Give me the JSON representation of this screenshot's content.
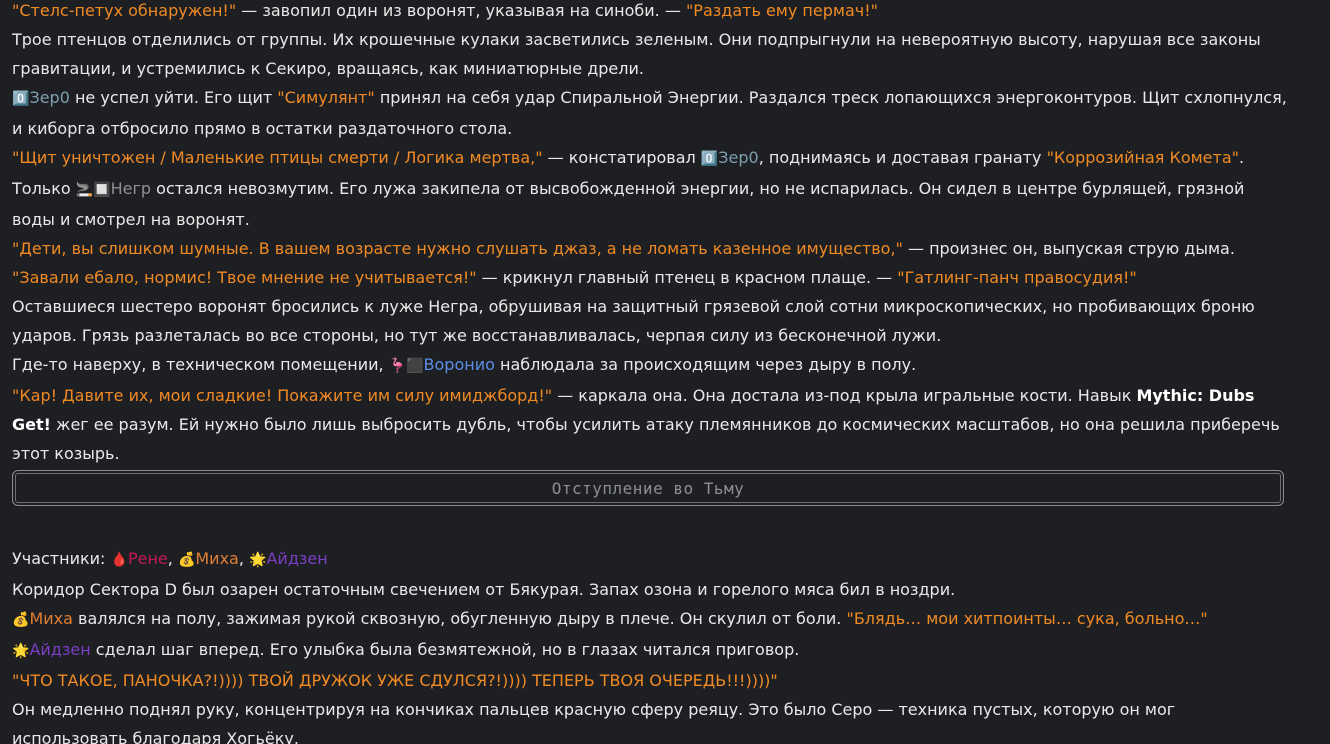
{
  "post1": {
    "l1_q1": "\"Стелс-петух обнаружен!\"",
    "l1_t": " — завопил один из воронят, указывая на синоби. — ",
    "l1_q2": "\"Раздать ему пермач!\"",
    "l2": "Трое птенцов отделились от группы. Их крошечные кулаки засветились зеленым. Они подпрыгнули на невероятную высоту, нарушая все законы гравитации, и устремились к Секиро, вращаясь, как миниатюрные дрели.",
    "l3_icon": "0️⃣",
    "l3_name": "Зер0",
    "l3_t1": " не успел уйти. Его щит ",
    "l3_q": "\"Симулянт\"",
    "l3_t2": " принял на себя удар Спиральной Энергии. Раздался треск лопающихся энергоконтуров. Щит схлопнулся, и киборга отбросило прямо в остатки раздаточного стола.",
    "l4_q1": "\"Щит уничтожен / Маленькие птицы смерти / Логика мертва,\"",
    "l4_t1": " — констатировал ",
    "l4_icon": "0️⃣",
    "l4_name": "Зер0",
    "l4_t2": ", поднимаясь и доставая гранату ",
    "l4_q2": "\"Коррозийная Комета\"",
    "l4_t3": ".",
    "l5_t1": "Только ",
    "l5_icon": "🚬🔲",
    "l5_name": "Негр",
    "l5_t2": " остался невозмутим. Его лужа закипела от высвобожденной энергии, но не испарилась. Он сидел в центре бурлящей, грязной воды и смотрел на воронят.",
    "l6_q": "\"Дети, вы слишком шумные. В вашем возрасте нужно слушать джаз, а не ломать казенное имущество,\"",
    "l6_t": " — произнес он, выпуская струю дыма.",
    "l7_q1": "\"Завали ебало, нормис! Твое мнение не учитывается!\"",
    "l7_t": " — крикнул главный птенец в красном плаще. — ",
    "l7_q2": "\"Гатлинг-панч правосудия!\"",
    "l8": "Оставшиеся шестеро воронят бросились к луже Негра, обрушивая на защитный грязевой слой сотни микроскопических, но пробивающих броню ударов. Грязь разлеталась во все стороны, но тут же восстанавливалась, черпая силу из бесконечной лужи.",
    "l9_t1": "Где-то наверху, в техническом помещении, ",
    "l9_icon": "🦩⬛",
    "l9_name": "Воронио",
    "l9_t2": " наблюдала за происходящим через дыру в полу.",
    "l10_q": "\"Кар! Давите их, мои сладкие! Покажите им силу имиджборд!\"",
    "l10_t1": " — каркала она. Она достала из-под крыла игральные кости. Навык ",
    "l10_b": "Mythic: Dubs Get!",
    "l10_t2": " жег ее разум. Ей нужно было лишь выбросить дубль, чтобы усилить атаку племянников до космических масштабов, но она решила приберечь этот козырь."
  },
  "button": {
    "label": "Отступление во Тьму"
  },
  "post2": {
    "participants_label": "Участники: ",
    "rene_icon": "🩸",
    "rene": "Рене",
    "miha_icon": "💰",
    "miha": "Миха",
    "aizen_icon": "🌟",
    "aizen": "Айдзен",
    "sep": ", ",
    "p1": "Коридор Сектора D был озарен остаточным свечением от Бякурая. Запах озона и горелого мяса бил в ноздри.",
    "p2_icon": "💰",
    "p2_name": "Миха",
    "p2_t": " валялся на полу, зажимая рукой сквозную, обугленную дыру в плече. Он скулил от боли. ",
    "p2_q": "\"Блядь… мои хитпоинты… сука, больно…\"",
    "p3_icon": "🌟",
    "p3_name": "Айдзен",
    "p3_t": " сделал шаг вперед. Его улыбка была безмятежной, но в глазах читался приговор.",
    "p4_q": "\"ЧТО ТАКОЕ, ПАНОЧКА?!)))) ТВОЙ ДРУЖОК УЖЕ СДУЛСЯ?!)))) ТЕПЕРЬ ТВОЯ ОЧЕРЕДЬ!!!))))\"",
    "p5": "Он медленно поднял руку, концентрируя на кончиках пальцев красную сферу реяцу. Это было Серо — техника пустых, которую он мог использовать благодаря Хогьёку."
  },
  "colors": {
    "background": "#1e1f22",
    "text": "#e9e9ea",
    "quote": "#f08a24",
    "zero": "#7d9fb0",
    "voronio": "#5a8de6",
    "rene": "#c2185b",
    "miha": "#e07f34",
    "aizen": "#7a3fc4"
  }
}
